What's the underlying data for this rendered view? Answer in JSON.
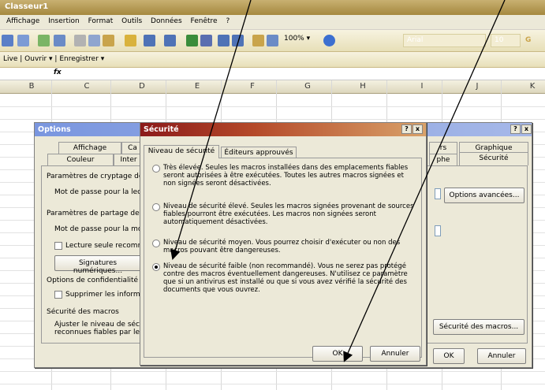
{
  "window": {
    "title": "Classeur1"
  },
  "menu": [
    "Affichage",
    "Insertion",
    "Format",
    "Outils",
    "Données",
    "Fenêtre",
    "?"
  ],
  "toolbar": {
    "zoom": "100%",
    "font_name": "Arial",
    "font_size": "10",
    "font_bold": "G"
  },
  "toolbar2": {
    "live": "Live",
    "ouvrir": "Ouvrir",
    "enregistrer": "Enregistrer"
  },
  "formula": {
    "fx": "fx"
  },
  "columns": [
    "B",
    "C",
    "D",
    "E",
    "F",
    "G",
    "H",
    "I",
    "J",
    "K"
  ],
  "options_dialog": {
    "title": "Options",
    "tabs_row1": [
      "Affichage",
      "Ca",
      "rs",
      "Graphique"
    ],
    "tabs_row2": [
      "Couleur",
      "Inter",
      "phe",
      "Sécurité"
    ],
    "section_cryptage": "Paramètres de cryptage de",
    "mdp_lecture": "Mot de passe pour la lectu",
    "section_partage": "Paramètres de partage de fi",
    "mdp_modif": "Mot de passe pour la modi",
    "lecture_seule": "Lecture seule recomma",
    "signatures": "Signatures numériques...",
    "confidentialite": "Options de confidentialité",
    "supprimer": "Supprimer les informati",
    "securite_macros": "Sécurité des macros",
    "ajuster1": "Ajuster le niveau de sécur",
    "ajuster2": "reconnues fiables par les c",
    "options_avancees": "Options avancées...",
    "securite_macros_btn": "Sécurité des macros...",
    "ok": "OK",
    "annuler": "Annuler"
  },
  "security_dialog": {
    "title": "Sécurité",
    "help": "?",
    "close": "x",
    "tabs": [
      "Niveau de sécurité",
      "Éditeurs approuvés"
    ],
    "options": [
      {
        "line1": "Très élevée. Seules les macros installées dans des emplacements fiables",
        "line2": "seront autorisées à être exécutées. Toutes les autres macros signées et",
        "line3": "non signées seront désactivées.",
        "line4": "",
        "selected": false
      },
      {
        "line1": "Niveau de sécurité élevé. Seules les macros signées provenant de sources",
        "line2": "fiables pourront être exécutées. Les macros non signées seront",
        "line3": "automatiquement désactivées.",
        "line4": "",
        "selected": false
      },
      {
        "line1": "Niveau de sécurité moyen. Vous pourrez choisir d'exécuter ou non des",
        "line2": "macros pouvant être dangereuses.",
        "line3": "",
        "line4": "",
        "selected": false
      },
      {
        "line1": "Niveau de sécurité faible (non recommandé). Vous ne serez pas protégé",
        "line2": "contre des macros éventuellement dangereuses. N'utilisez ce paramètre",
        "line3": "que si un antivirus est installé ou que si vous avez vérifié la sécurité des",
        "line4": "documents que vous ouvrez.",
        "selected": true
      }
    ],
    "ok": "OK",
    "annuler": "Annuler"
  },
  "colors": {
    "title_active": "#0a246a",
    "title_inactive": "#7a96df",
    "security_title_start": "#8b1a1a",
    "security_title_end": "#d9a26a"
  }
}
